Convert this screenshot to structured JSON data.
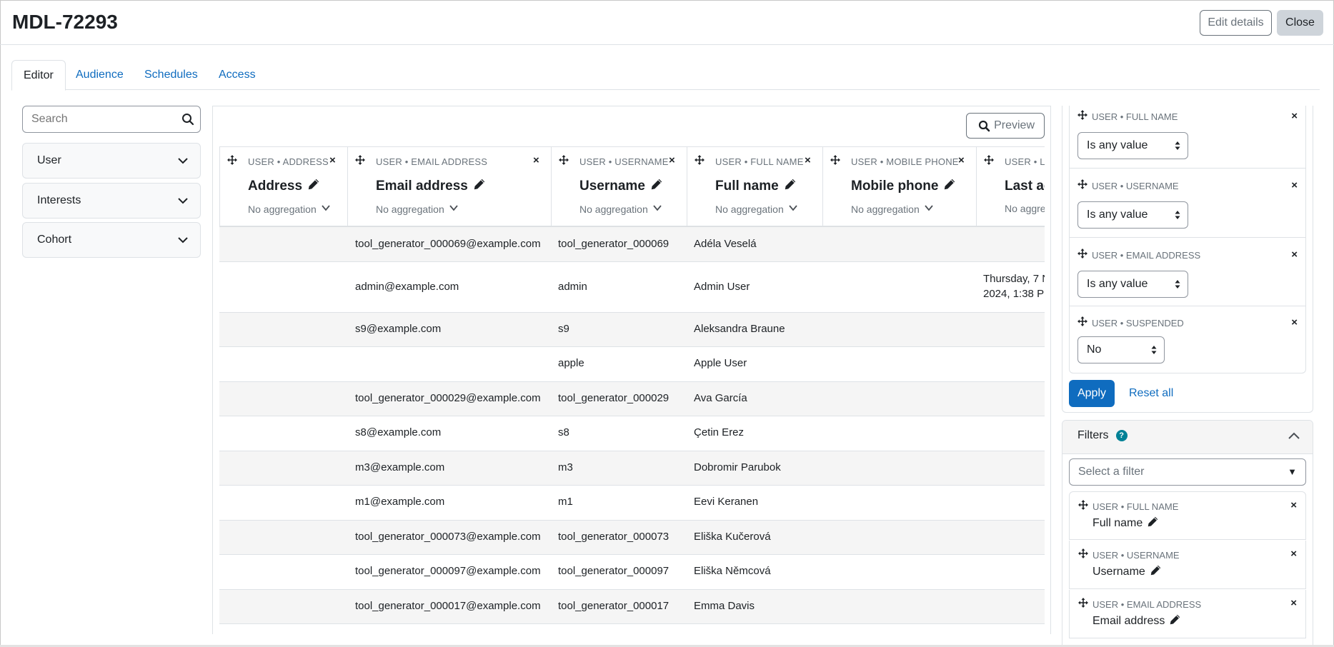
{
  "header": {
    "title": "MDL-72293",
    "edit_label": "Edit details",
    "close_label": "Close"
  },
  "tabs": [
    {
      "label": "Editor"
    },
    {
      "label": "Audience"
    },
    {
      "label": "Schedules"
    },
    {
      "label": "Access"
    }
  ],
  "sidebar": {
    "search_placeholder": "Search",
    "items": [
      {
        "label": "User"
      },
      {
        "label": "Interests"
      },
      {
        "label": "Cohort"
      }
    ]
  },
  "toolbar": {
    "preview_label": "Preview"
  },
  "columns": [
    {
      "source": "USER • ADDRESS",
      "title": "Address",
      "aggregation": "No aggregation"
    },
    {
      "source": "USER • EMAIL ADDRESS",
      "title": "Email address",
      "aggregation": "No aggregation"
    },
    {
      "source": "USER • USERNAME",
      "title": "Username",
      "aggregation": "No aggregation"
    },
    {
      "source": "USER • FULL NAME",
      "title": "Full name",
      "aggregation": "No aggregation"
    },
    {
      "source": "USER • MOBILE PHONE",
      "title": "Mobile phone",
      "aggregation": "No aggregation"
    },
    {
      "source": "USER • LA",
      "title": "Last ac",
      "aggregation": "No aggreg"
    }
  ],
  "rows": [
    {
      "email": "tool_generator_000069@example.com",
      "username": "tool_generator_000069",
      "fullname": "Adéla Veselá",
      "last": ""
    },
    {
      "email": "admin@example.com",
      "username": "admin",
      "fullname": "Admin User",
      "last": "Thursday, 7 N",
      "last2": "2024, 1:38 P"
    },
    {
      "email": "s9@example.com",
      "username": "s9",
      "fullname": "Aleksandra Braune",
      "last": ""
    },
    {
      "email": "",
      "username": "apple",
      "fullname": "Apple User",
      "last": ""
    },
    {
      "email": "tool_generator_000029@example.com",
      "username": "tool_generator_000029",
      "fullname": "Ava García",
      "last": ""
    },
    {
      "email": "s8@example.com",
      "username": "s8",
      "fullname": "Çetin Erez",
      "last": ""
    },
    {
      "email": "m3@example.com",
      "username": "m3",
      "fullname": "Dobromir Parubok",
      "last": ""
    },
    {
      "email": "m1@example.com",
      "username": "m1",
      "fullname": "Eevi Keranen",
      "last": ""
    },
    {
      "email": "tool_generator_000073@example.com",
      "username": "tool_generator_000073",
      "fullname": "Eliška Kučerová",
      "last": ""
    },
    {
      "email": "tool_generator_000097@example.com",
      "username": "tool_generator_000097",
      "fullname": "Eliška Němcová",
      "last": ""
    },
    {
      "email": "tool_generator_000017@example.com",
      "username": "tool_generator_000017",
      "fullname": "Emma Davis",
      "last": ""
    }
  ],
  "conditions": [
    {
      "source": "USER • FULL NAME",
      "value": "Is any value"
    },
    {
      "source": "USER • USERNAME",
      "value": "Is any value"
    },
    {
      "source": "USER • EMAIL ADDRESS",
      "value": "Is any value"
    },
    {
      "source": "USER • SUSPENDED",
      "value": "No"
    }
  ],
  "condition_actions": {
    "apply_label": "Apply",
    "reset_label": "Reset all"
  },
  "filters": {
    "title": "Filters",
    "help": "?",
    "select_placeholder": "Select a filter",
    "items": [
      {
        "source": "USER • FULL NAME",
        "name": "Full name"
      },
      {
        "source": "USER • USERNAME",
        "name": "Username"
      },
      {
        "source": "USER • EMAIL ADDRESS",
        "name": "Email address"
      }
    ]
  },
  "colors": {
    "accent": "#0f6cbf",
    "help": "#008196",
    "border": "#dee2e6"
  }
}
